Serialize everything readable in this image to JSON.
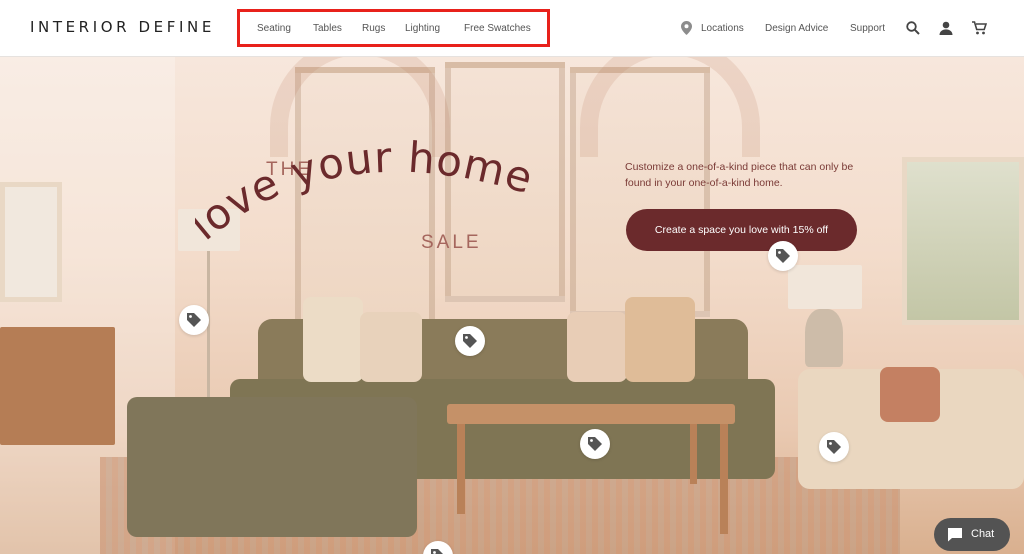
{
  "header": {
    "brand": "INTERIOR DEFINE",
    "nav": [
      "Seating",
      "Tables",
      "Rugs",
      "Lighting",
      "Free Swatches"
    ],
    "locations_label": "Locations",
    "design_advice_label": "Design Advice",
    "support_label": "Support",
    "icons": [
      "location-pin-icon",
      "search-icon",
      "account-icon",
      "cart-icon"
    ]
  },
  "hero": {
    "the_text": "THE",
    "headline": "love your home",
    "sale_text": "SALE",
    "tagline": "Customize a one-of-a-kind piece that can only be found in your one-of-a-kind home.",
    "cta_label": "Create a space you love with 15% off",
    "accent": "#6b2a2c",
    "headline_color": "#6b2a2c"
  },
  "chat": {
    "label": "Chat"
  },
  "highlight": {
    "color": "#e8211b"
  }
}
